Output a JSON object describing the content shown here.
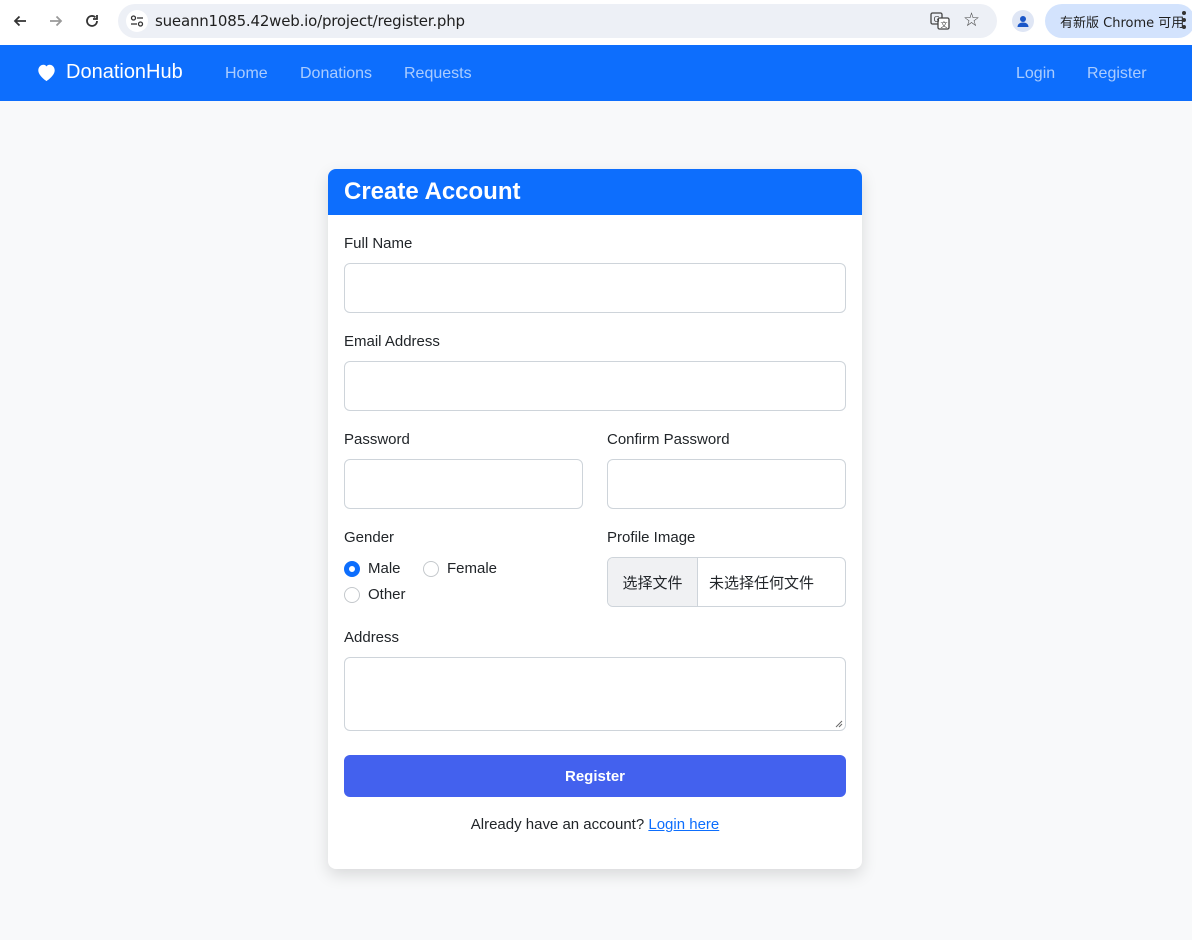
{
  "browser": {
    "url": "sueann1085.42web.io/project/register.php",
    "update_label": "有新版 Chrome 可用"
  },
  "navbar": {
    "brand": "DonationHub",
    "links": [
      {
        "label": "Home"
      },
      {
        "label": "Donations"
      },
      {
        "label": "Requests"
      }
    ],
    "right_links": [
      {
        "label": "Login"
      },
      {
        "label": "Register"
      }
    ]
  },
  "form": {
    "title": "Create Account",
    "full_name_label": "Full Name",
    "full_name_value": "",
    "email_label": "Email Address",
    "email_value": "",
    "password_label": "Password",
    "confirm_password_label": "Confirm Password",
    "gender_label": "Gender",
    "gender_options": [
      {
        "label": "Male",
        "checked": true
      },
      {
        "label": "Female",
        "checked": false
      },
      {
        "label": "Other",
        "checked": false
      }
    ],
    "profile_image_label": "Profile Image",
    "file_button_label": "选择文件",
    "file_status": "未选择任何文件",
    "address_label": "Address",
    "address_value": "",
    "submit_label": "Register",
    "footer_prompt": "Already have an account?",
    "footer_link": "Login here"
  },
  "colors": {
    "primary": "#0d6efd",
    "submit": "#4361ee",
    "background": "#f8f9fa"
  }
}
